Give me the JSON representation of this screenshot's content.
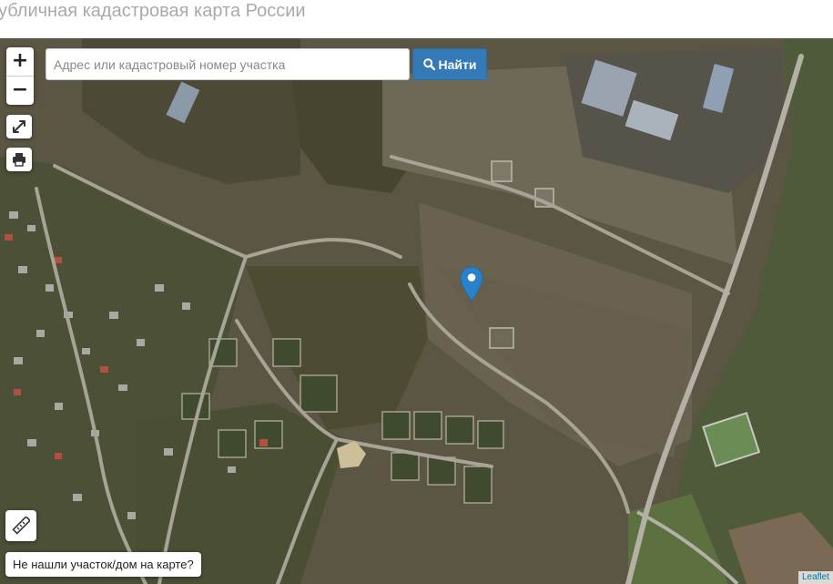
{
  "page": {
    "title": "убличная кадастровая карта России"
  },
  "controls": {
    "zoom_in_label": "+",
    "zoom_out_label": "−",
    "search_placeholder": "Адрес или кадастровый номер участка",
    "search_value": "",
    "find_button_label": "Найти",
    "not_found_label": "Не нашли участок/дом на карте?"
  },
  "map": {
    "view": "satellite",
    "marker_color": "#2a81cb",
    "attribution": "Leaflet"
  },
  "colors": {
    "accent": "#337ab7",
    "title_text": "#a9a9a9"
  }
}
